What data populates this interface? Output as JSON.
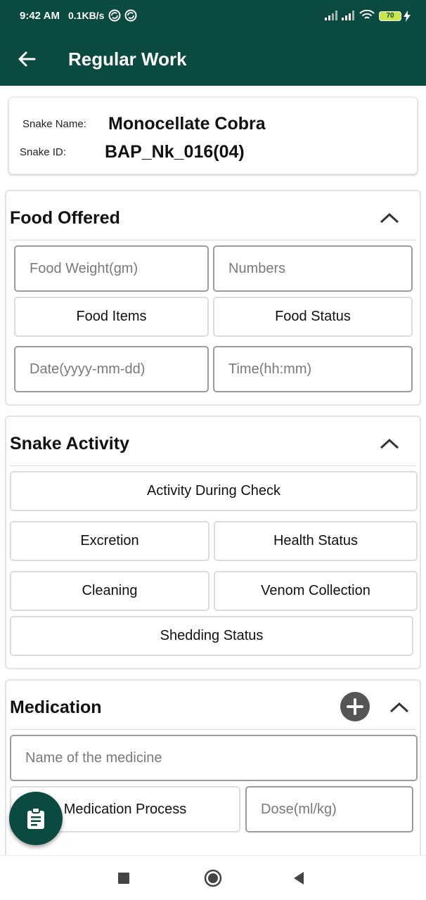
{
  "status_bar": {
    "time": "9:42 AM",
    "speed": "0.1KB/s",
    "battery": "70"
  },
  "app_bar": {
    "title": "Regular Work",
    "back_icon": "arrow-left-icon"
  },
  "snake_info": {
    "name_label": "Snake Name:",
    "name_value": "Monocellate Cobra",
    "id_label": "Snake ID:",
    "id_value": "BAP_Nk_016(04)"
  },
  "food_offered": {
    "title": "Food Offered",
    "weight_placeholder": "Food Weight(gm)",
    "numbers_placeholder": "Numbers",
    "food_items_label": "Food Items",
    "food_status_label": "Food Status",
    "date_placeholder": "Date(yyyy-mm-dd)",
    "time_placeholder": "Time(hh:mm)"
  },
  "snake_activity": {
    "title": "Snake Activity",
    "activity_label": "Activity During Check",
    "excretion_label": "Excretion",
    "health_label": "Health Status",
    "cleaning_label": "Cleaning",
    "venom_label": "Venom Collection",
    "shedding_label": "Shedding Status"
  },
  "medication": {
    "title": "Medication",
    "medicine_placeholder": "Name of the medicine",
    "process_label": "Medication Process",
    "dose_placeholder": "Dose(ml/kg)"
  },
  "colors": {
    "primary": "#0b4a40",
    "icon_gray": "#555555"
  },
  "icons": {
    "collapse": "chevron-up-icon",
    "add": "plus-circle-icon",
    "fab": "clipboard-icon",
    "nav": [
      "square-icon",
      "circle-icon",
      "triangle-back-icon"
    ]
  }
}
